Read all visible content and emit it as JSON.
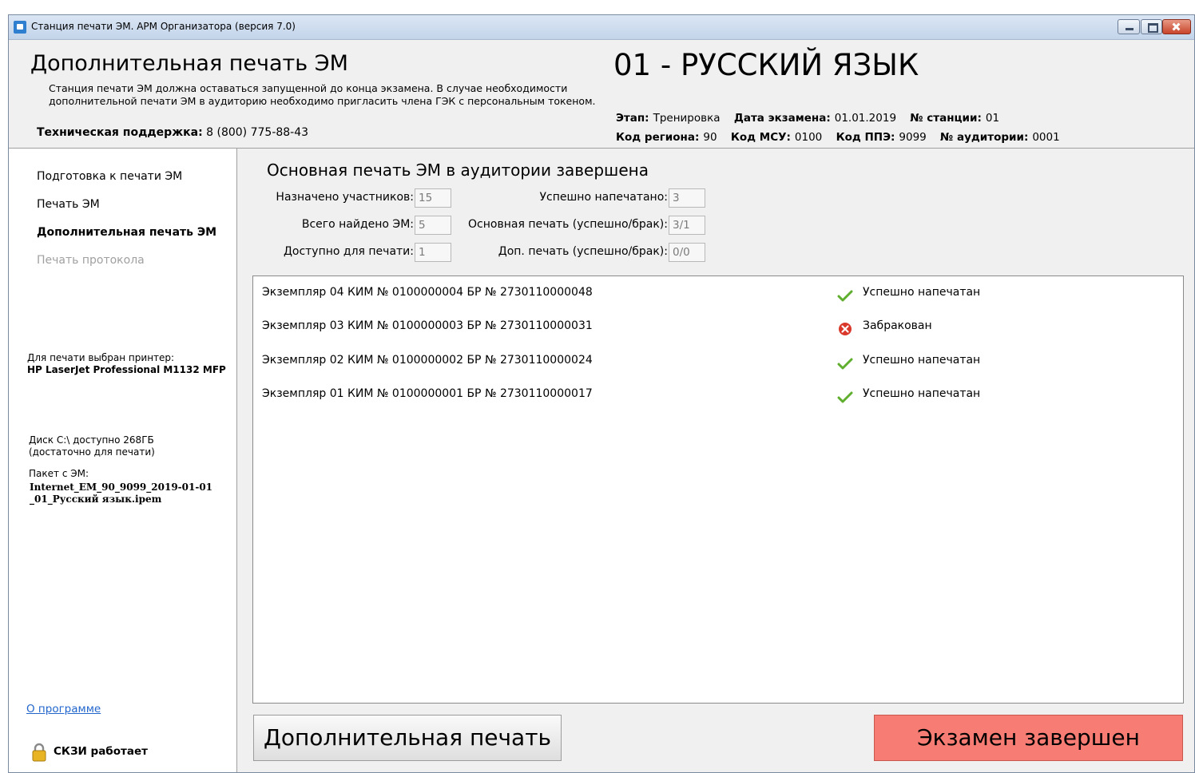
{
  "window": {
    "title": "Станция печати ЭМ. АРМ Организатора (версия 7.0)"
  },
  "header": {
    "title": "Дополнительная печать ЭМ",
    "description": "Станция печати ЭМ должна оставаться запущенной до конца экзамена. В случае необходимости дополнительной печати ЭМ в аудиторию необходимо пригласить члена ГЭК с персональным токеном.",
    "support_label": "Техническая поддержка:",
    "support_phone": "8 (800) 775-88-43",
    "subject": "01 - РУССКИЙ ЯЗЫК",
    "meta_row1": [
      {
        "label": "Этап:",
        "value": "Тренировка"
      },
      {
        "label": "Дата экзамена:",
        "value": "01.01.2019"
      },
      {
        "label": "№ станции:",
        "value": "01"
      }
    ],
    "meta_row2": [
      {
        "label": "Код региона:",
        "value": "90"
      },
      {
        "label": "Код МСУ:",
        "value": "0100"
      },
      {
        "label": "Код ППЭ:",
        "value": "9099"
      },
      {
        "label": "№ аудитории:",
        "value": "0001"
      }
    ]
  },
  "sidebar": {
    "nav": [
      {
        "label": "Подготовка к печати ЭМ",
        "state": "normal"
      },
      {
        "label": "Печать ЭМ",
        "state": "normal"
      },
      {
        "label": "Дополнительная печать ЭМ",
        "state": "active"
      },
      {
        "label": "Печать протокола",
        "state": "disabled"
      }
    ],
    "printer_label": "Для печати выбран принтер:",
    "printer_name": "HP LaserJet Professional M1132 MFP",
    "disk_line1": "Диск C:\\ доступно 268ГБ",
    "disk_line2": "(достаточно для печати)",
    "package_label": "Пакет с ЭМ:",
    "package_line1": "Internet_EM_90_9099_2019-01-01",
    "package_line2": "_01_Русский язык.ipem",
    "about_link": "О программе",
    "skzi_status": "СКЗИ работает"
  },
  "main": {
    "title": "Основная печать ЭМ в аудитории завершена",
    "fields": {
      "assigned_label": "Назначено участников:",
      "assigned": "15",
      "found_label": "Всего найдено ЭМ:",
      "found": "5",
      "available_label": "Доступно для печати:",
      "available": "1",
      "printed_label": "Успешно напечатано:",
      "printed": "3",
      "main_print_label": "Основная печать (успешно/брак):",
      "main_print": "3/1",
      "extra_print_label": "Доп. печать (успешно/брак):",
      "extra_print": "0/0"
    },
    "rows": [
      {
        "text": "Экземпляр 04  КИМ № 0100000004  БР № 2730110000048",
        "status": "Успешно напечатан",
        "status_type": "ok"
      },
      {
        "text": "Экземпляр 03  КИМ № 0100000003  БР № 2730110000031",
        "status": "Забракован",
        "status_type": "error"
      },
      {
        "text": "Экземпляр 02  КИМ № 0100000002  БР № 2730110000024",
        "status": "Успешно напечатан",
        "status_type": "ok"
      },
      {
        "text": "Экземпляр 01  КИМ № 0100000001  БР № 2730110000017",
        "status": "Успешно напечатан",
        "status_type": "ok"
      }
    ],
    "btn_additional": "Дополнительная печать",
    "btn_finish": "Экзамен завершен"
  },
  "colors": {
    "finish_button": "#f77d74",
    "ok": "#5fae2e",
    "error": "#d9382a",
    "link": "#2266cc"
  }
}
